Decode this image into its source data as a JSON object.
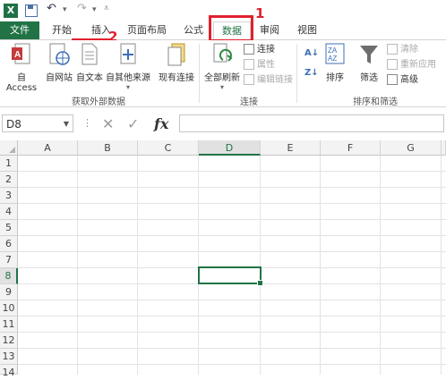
{
  "qat": {
    "app_icon": "X"
  },
  "tabs": {
    "file": "文件",
    "home": "开始",
    "insert": "插入",
    "page_layout": "页面布局",
    "formulas": "公式",
    "data": "数据",
    "review": "审阅",
    "view": "视图"
  },
  "annotations": {
    "one": "1",
    "two": "2"
  },
  "ribbon": {
    "get_external": {
      "access": "自 Access",
      "web": "自网站",
      "text": "自文本",
      "other": "自其他来源",
      "existing": "现有连接",
      "group_label": "获取外部数据"
    },
    "connections": {
      "refresh_all": "全部刷新",
      "connections": "连接",
      "properties": "属性",
      "edit_links": "编辑链接",
      "group_label": "连接"
    },
    "sort_filter": {
      "sort": "排序",
      "filter": "筛选",
      "clear": "清除",
      "reapply": "重新应用",
      "advanced": "高级",
      "group_label": "排序和筛选"
    }
  },
  "formula_bar": {
    "name_box": "D8",
    "cancel": "✕",
    "enter": "✓",
    "fx": "fx",
    "content": ""
  },
  "grid": {
    "columns": [
      "A",
      "B",
      "C",
      "D",
      "E",
      "F",
      "G"
    ],
    "rows": [
      "1",
      "2",
      "3",
      "4",
      "5",
      "6",
      "7",
      "8",
      "9",
      "10",
      "11",
      "12",
      "13",
      "14"
    ],
    "selected_cell": "D8"
  },
  "colors": {
    "brand": "#217346",
    "annotation": "#e0202e"
  }
}
